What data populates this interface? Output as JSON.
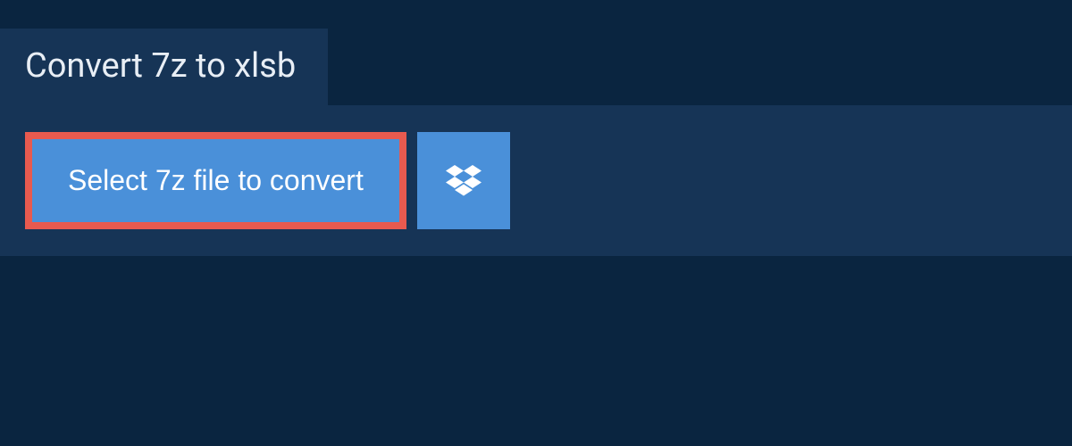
{
  "header": {
    "title": "Convert 7z to xlsb"
  },
  "actions": {
    "select_file_label": "Select 7z file to convert"
  },
  "colors": {
    "highlight_border": "#e85a4f",
    "button_bg": "#4a90d9",
    "panel_bg": "#163456",
    "page_bg": "#0a2540"
  }
}
